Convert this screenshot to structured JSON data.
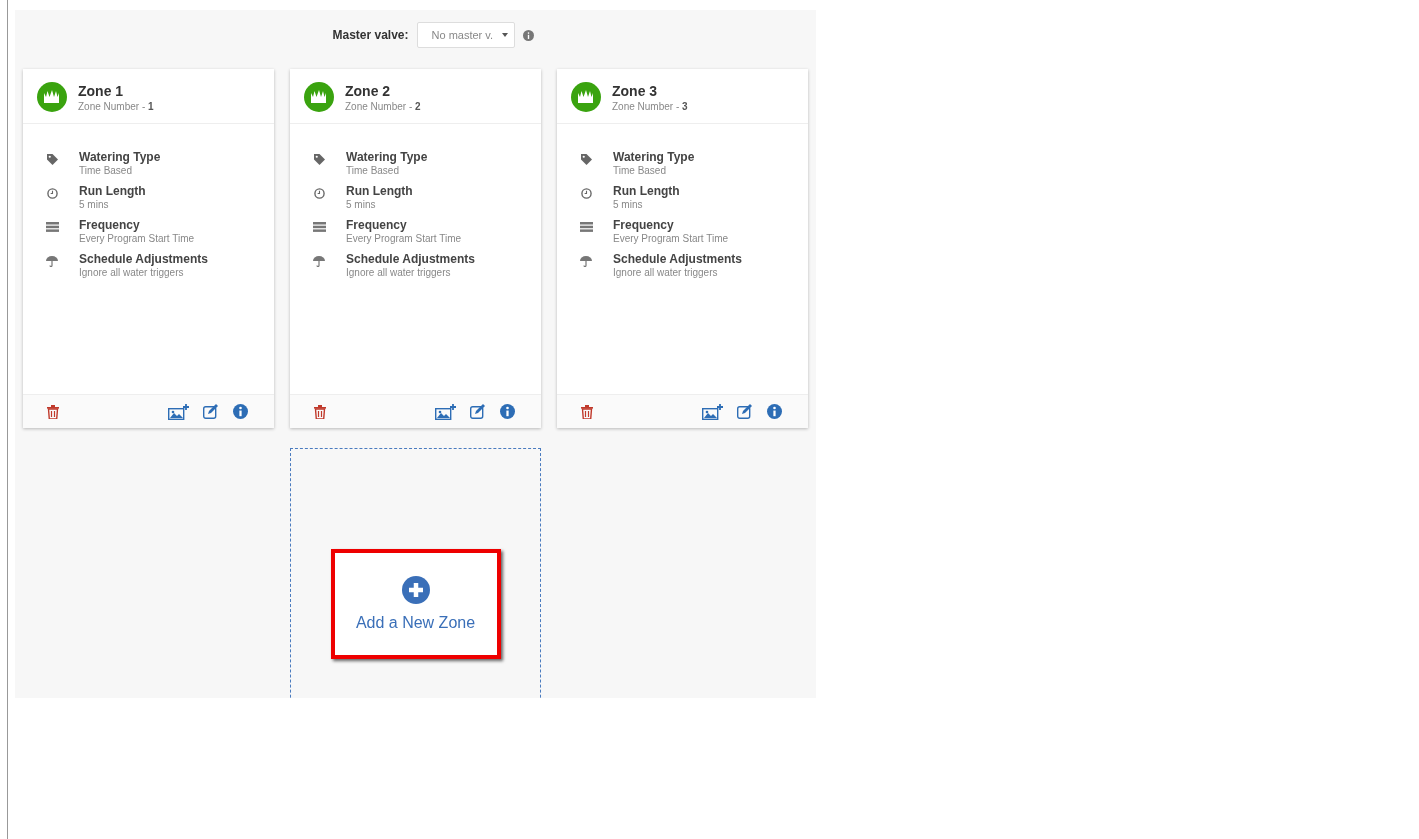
{
  "master_valve": {
    "label": "Master valve:",
    "value": "No master v."
  },
  "zones": [
    {
      "title": "Zone 1",
      "number_label": "Zone Number - ",
      "number": "1",
      "details": [
        {
          "kind": "tag",
          "label": "Watering Type",
          "value": "Time Based"
        },
        {
          "kind": "clock",
          "label": "Run Length",
          "value": "5 mins"
        },
        {
          "kind": "frequency",
          "label": "Frequency",
          "value": "Every Program Start Time"
        },
        {
          "kind": "umbrella",
          "label": "Schedule Adjustments",
          "value": "Ignore all water triggers"
        }
      ]
    },
    {
      "title": "Zone 2",
      "number_label": "Zone Number - ",
      "number": "2",
      "details": [
        {
          "kind": "tag",
          "label": "Watering Type",
          "value": "Time Based"
        },
        {
          "kind": "clock",
          "label": "Run Length",
          "value": "5 mins"
        },
        {
          "kind": "frequency",
          "label": "Frequency",
          "value": "Every Program Start Time"
        },
        {
          "kind": "umbrella",
          "label": "Schedule Adjustments",
          "value": "Ignore all water triggers"
        }
      ]
    },
    {
      "title": "Zone 3",
      "number_label": "Zone Number - ",
      "number": "3",
      "details": [
        {
          "kind": "tag",
          "label": "Watering Type",
          "value": "Time Based"
        },
        {
          "kind": "clock",
          "label": "Run Length",
          "value": "5 mins"
        },
        {
          "kind": "frequency",
          "label": "Frequency",
          "value": "Every Program Start Time"
        },
        {
          "kind": "umbrella",
          "label": "Schedule Adjustments",
          "value": "Ignore all water triggers"
        }
      ]
    }
  ],
  "add_zone": {
    "label": "Add a New Zone"
  }
}
